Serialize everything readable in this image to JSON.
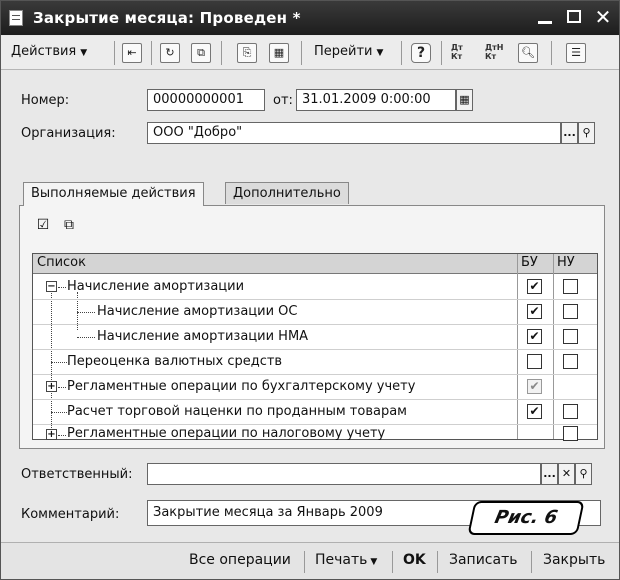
{
  "window": {
    "title": "Закрытие месяца: Проведен *"
  },
  "toolbar": {
    "actions_label": "Действия",
    "goto_label": "Перейти",
    "help_label": "?",
    "dtkt1": "Дт Кт",
    "dtkt2": "ДтН Кт"
  },
  "form": {
    "number_label": "Номер:",
    "number_value": "00000000001",
    "date_label": "от:",
    "date_value": "31.01.2009  0:00:00",
    "org_label": "Организация:",
    "org_value": "ООО \"Добро\"",
    "responsible_label": "Ответственный:",
    "responsible_value": "",
    "comment_label": "Комментарий:",
    "comment_value": "Закрытие месяца за Январь 2009"
  },
  "tabs": [
    {
      "label": "Выполняемые действия",
      "active": true
    },
    {
      "label": "Дополнительно",
      "active": false
    }
  ],
  "grid": {
    "headers": {
      "list": "Список",
      "bu": "БУ",
      "nu": "НУ"
    },
    "rows": [
      {
        "label": "Начисление амортизации",
        "bu": true,
        "nu": false
      },
      {
        "label": "Начисление амортизации ОС",
        "bu": true,
        "nu": false
      },
      {
        "label": "Начисление амортизации НМА",
        "bu": true,
        "nu": false
      },
      {
        "label": "Переоценка валютных средств",
        "bu": false,
        "nu": false
      },
      {
        "label": "Регламентные операции по бухгалтерскому учету",
        "bu": true,
        "nu": null
      },
      {
        "label": "Расчет торговой наценки по проданным товарам",
        "bu": true,
        "nu": false
      },
      {
        "label": "Регламентные операции по налоговому учету",
        "bu": null,
        "nu": false
      }
    ]
  },
  "footer": {
    "all_ops": "Все операции",
    "print": "Печать",
    "ok": "OK",
    "save": "Записать",
    "close": "Закрыть"
  },
  "caption": "Рис. 6",
  "colors": {
    "titlebar": "#2a2a2a",
    "window_bg": "#e8e8e8",
    "grid_header": "#d4d4d4"
  }
}
